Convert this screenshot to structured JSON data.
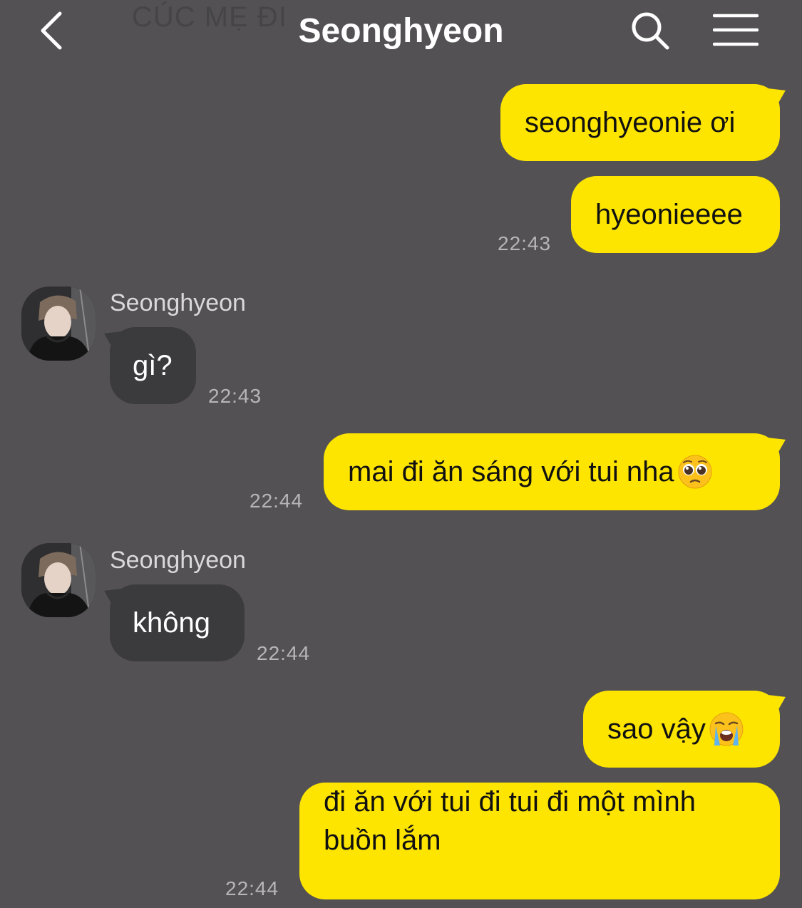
{
  "header": {
    "title": "Seonghyeon",
    "ghost_text": "CÚC MẸ ĐI",
    "back_icon": "chevron-left-icon",
    "search_icon": "search-icon",
    "menu_icon": "hamburger-menu-icon"
  },
  "colors": {
    "background": "#535154",
    "outgoing_bubble": "#fee500",
    "incoming_bubble": "#3b3a3d",
    "timestamp": "#b7b5b8"
  },
  "messages": [
    {
      "side": "out",
      "text": "seonghyeonie ơi"
    },
    {
      "side": "out",
      "text": "hyeonieeee",
      "time": "22:43"
    },
    {
      "side": "in",
      "sender": "Seonghyeon",
      "text": "gì?",
      "time": "22:43"
    },
    {
      "side": "out",
      "text": "mai đi ăn sáng với tui nha",
      "emoji": "pleading-face-emoji",
      "time": "22:44"
    },
    {
      "side": "in",
      "sender": "Seonghyeon",
      "text": "không",
      "time": "22:44"
    },
    {
      "side": "out",
      "text": "sao vậy",
      "emoji": "loudly-crying-face-emoji"
    },
    {
      "side": "out",
      "text": "đi ăn với tui đi tui đi một mình buồn lắm",
      "time": "22:44"
    }
  ]
}
